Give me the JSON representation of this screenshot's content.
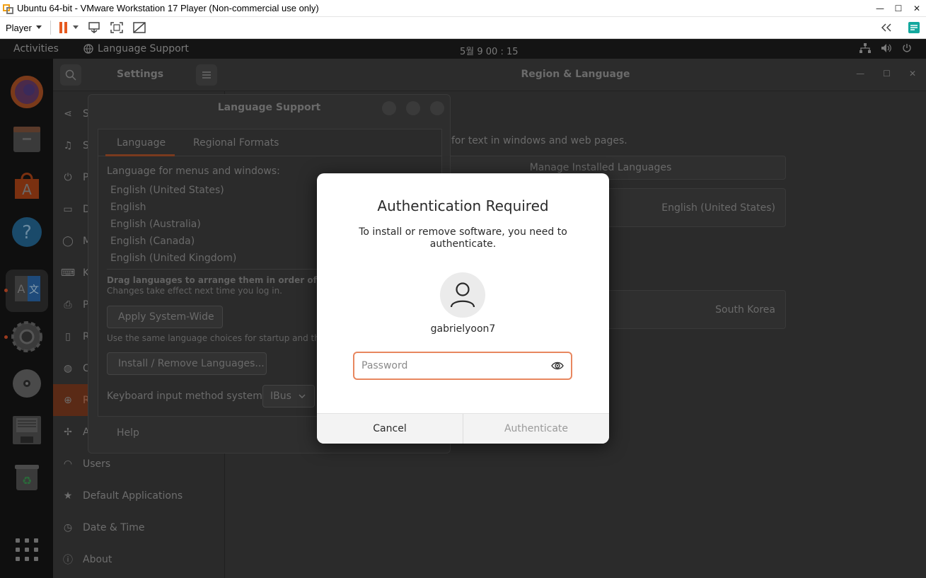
{
  "vm": {
    "title": "Ubuntu 64-bit - VMware Workstation 17 Player (Non-commercial use only)",
    "player_menu": "Player"
  },
  "topbar": {
    "activities": "Activities",
    "app_name": "Language Support",
    "clock": "5월 9  00 : 15"
  },
  "settings": {
    "title": "Settings",
    "main_title": "Region & Language",
    "sidebar": [
      {
        "label": "S",
        "icon": "share-icon"
      },
      {
        "label": "S",
        "icon": "music-note-icon"
      },
      {
        "label": "P",
        "icon": "power-icon"
      },
      {
        "label": "D",
        "icon": "display-icon"
      },
      {
        "label": "M",
        "icon": "mouse-icon"
      },
      {
        "label": "K",
        "icon": "keyboard-icon"
      },
      {
        "label": "P",
        "icon": "printer-icon"
      },
      {
        "label": "R",
        "icon": "removable-media-icon"
      },
      {
        "label": "C",
        "icon": "color-icon"
      },
      {
        "label": "R",
        "icon": "globe-icon"
      },
      {
        "label": "A",
        "icon": "accessibility-icon"
      },
      {
        "label": "Users",
        "icon": "user-icon"
      },
      {
        "label": "Default Applications",
        "icon": "star-icon"
      },
      {
        "label": "Date & Time",
        "icon": "clock-icon"
      },
      {
        "label": "About",
        "icon": "info-icon"
      }
    ],
    "main": {
      "desc": "for text in windows and web pages.",
      "manage_btn": "Manage Installed Languages",
      "language_value": "English (United States)",
      "formats_value": "South Korea"
    }
  },
  "langsupport": {
    "title": "Language Support",
    "tabs": [
      "Language",
      "Regional Formats"
    ],
    "menus_label": "Language for menus and windows:",
    "languages": [
      "English (United States)",
      "English",
      "English (Australia)",
      "English (Canada)",
      "English (United Kingdom)"
    ],
    "drag_hint": "Drag languages to arrange them in order of prefere",
    "changes_hint": "Changes take effect next time you log in.",
    "apply_btn": "Apply System-Wide",
    "same_hint": "Use the same language choices for startup and the log",
    "install_btn": "Install / Remove Languages...",
    "keyboard_label": "Keyboard input method system:",
    "keyboard_value": "IBus",
    "help": "Help"
  },
  "auth": {
    "title": "Authentication Required",
    "message": "To install or remove software, you need to authenticate.",
    "username": "gabrielyoon7",
    "password_placeholder": "Password",
    "cancel": "Cancel",
    "authenticate": "Authenticate"
  },
  "colors": {
    "accent": "#e95420",
    "focus": "#e8875f"
  }
}
